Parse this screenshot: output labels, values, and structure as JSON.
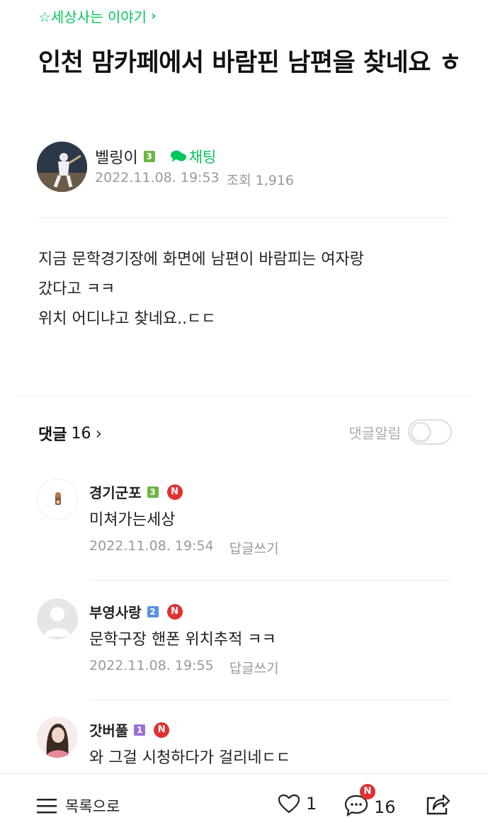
{
  "board": {
    "label": "☆세상사는 이야기",
    "chevron": "›"
  },
  "post": {
    "title": "인천 맘카페에서 바람핀 남편을 찾네요 ㅎ",
    "author": {
      "name": "벨링이",
      "level": "3",
      "chat_label": "채팅"
    },
    "date": "2022.11.08. 19:53",
    "views": "조회 1,916",
    "body": [
      "지금 문학경기장에 화면에 남편이 바람피는 여자랑",
      "갔다고 ㅋㅋ",
      "위치 어디냐고 찾네요..ㄷㄷ"
    ]
  },
  "comments_header": {
    "label": "댓글",
    "count": "16",
    "chevron": "›",
    "alarm_label": "댓글알림",
    "alarm_on": false
  },
  "comments": [
    {
      "name": "경기군포",
      "level": "3",
      "new": "N",
      "text": "미쳐가는세상",
      "date": "2022.11.08. 19:54",
      "reply": "답글쓰기"
    },
    {
      "name": "부영사랑",
      "level": "2",
      "new": "N",
      "text": "문학구장 핸폰 위치추적 ㅋㅋ",
      "date": "2022.11.08. 19:55",
      "reply": "답글쓰기"
    },
    {
      "name": "갓버풀",
      "level": "1",
      "new": "N",
      "text": "와 그걸 시청하다가 걸리네ㄷㄷ"
    }
  ],
  "bottom": {
    "list_label": "목록으로",
    "likes": "1",
    "comment_count": "16",
    "comment_badge": "N"
  },
  "colors": {
    "accent": "#03c75a",
    "badge_red": "#e03131"
  }
}
